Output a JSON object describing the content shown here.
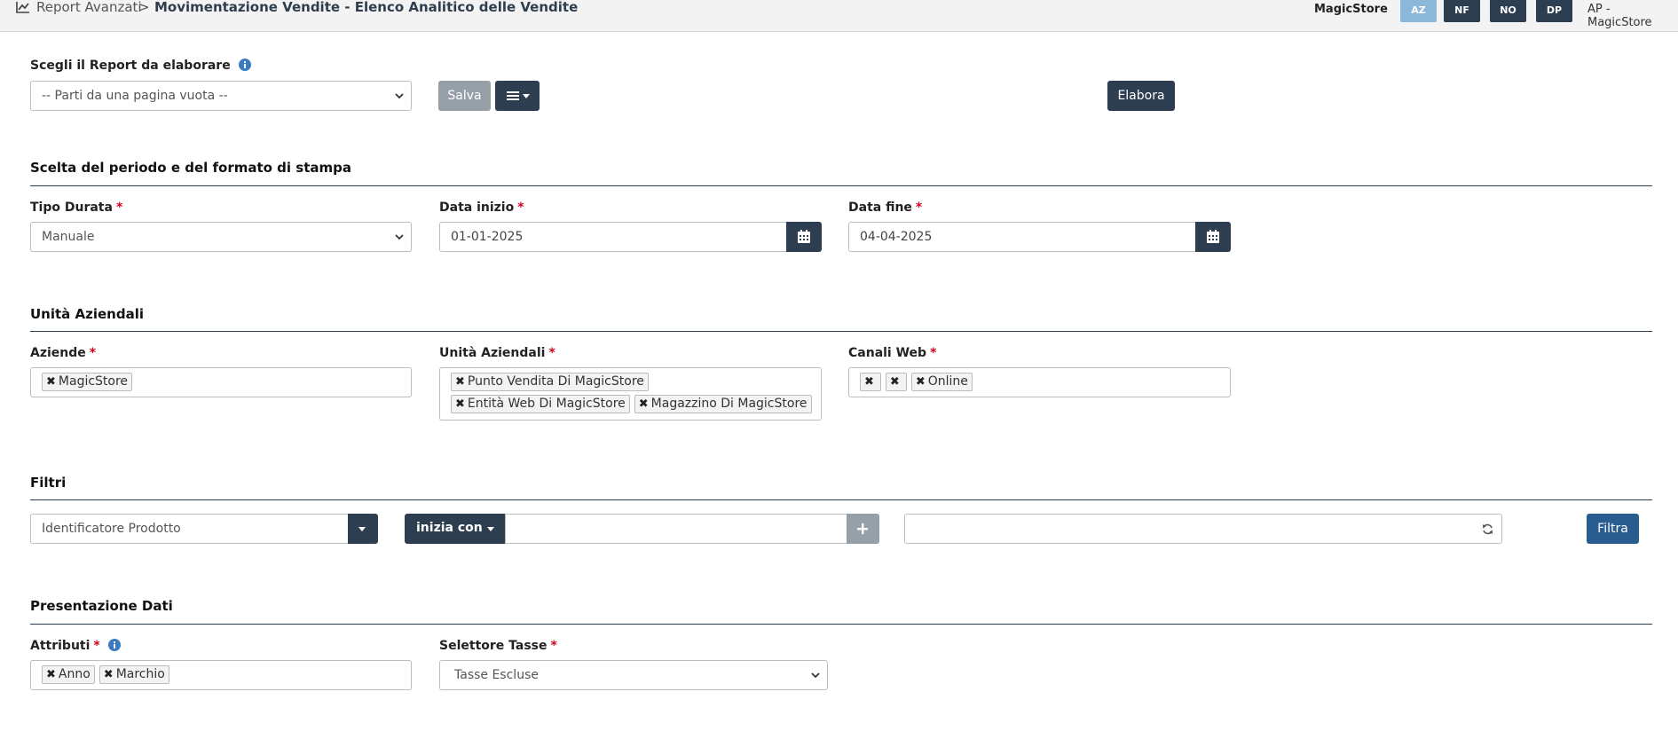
{
  "breadcrumb": {
    "root": "Report Avanzati",
    "separator": ">",
    "current": "Movimentazione Vendite - Elenco Analitico delle Vendite"
  },
  "topbar": {
    "store": "MagicStore",
    "buttons": [
      {
        "label": "AZ",
        "color": "#8bb8d9"
      },
      {
        "label": "NF",
        "color": "#2d3e50"
      },
      {
        "label": "NO",
        "color": "#2d3e50"
      },
      {
        "label": "DP",
        "color": "#2d3e50"
      }
    ],
    "user": "AP - MagicStore"
  },
  "report": {
    "label": "Scegli il Report da elaborare",
    "selected": "-- Parti da una pagina vuota --",
    "save_label": "Salva",
    "process_label": "Elabora"
  },
  "period": {
    "title": "Scelta del periodo e del formato di stampa",
    "duration_label": "Tipo Durata",
    "duration_value": "Manuale",
    "start_label": "Data inizio",
    "start_value": "01-01-2025",
    "end_label": "Data fine",
    "end_value": "04-04-2025"
  },
  "units": {
    "title": "Unità Aziendali",
    "companies_label": "Aziende",
    "companies": [
      "MagicStore"
    ],
    "units_label": "Unità Aziendali",
    "units": [
      "Punto Vendita Di MagicStore",
      "Entità Web Di MagicStore",
      "Magazzino Di MagicStore"
    ],
    "channels_label": "Canali Web",
    "channels": [
      "",
      "",
      "Online"
    ]
  },
  "filters": {
    "title": "Filtri",
    "field": "Identificatore Prodotto",
    "operator": "inizia con",
    "value": "",
    "filter_label": "Filtra"
  },
  "presentation": {
    "title": "Presentazione Dati",
    "attributes_label": "Attributi",
    "attributes": [
      "Anno",
      "Marchio"
    ],
    "tax_label": "Selettore Tasse",
    "tax_value": "Tasse Escluse"
  },
  "colors": {
    "dark": "#2d3e50",
    "filter_blue": "#2a5d8f",
    "required": "#d0021b"
  }
}
